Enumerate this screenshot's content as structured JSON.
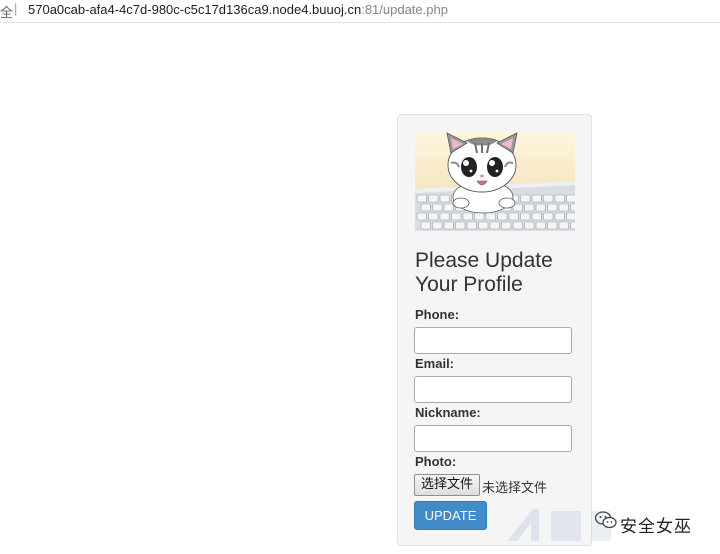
{
  "browser": {
    "secure_label": "全",
    "separator": "|",
    "url_host": "570a0cab-afa4-4c7d-980c-c5c17d136ca9.node4.buuoj.cn",
    "url_path": ":81/update.php"
  },
  "form": {
    "hero_image": "cat-on-keyboard-image",
    "title": "Please Update Your Profile",
    "phone_label": "Phone:",
    "phone_value": "",
    "email_label": "Email:",
    "email_value": "",
    "nickname_label": "Nickname:",
    "nickname_value": "",
    "photo_label": "Photo:",
    "file_button_label": "选择文件",
    "file_status": "未选择文件",
    "submit_label": "UPDATE"
  },
  "watermark": {
    "text": "安全女巫",
    "icon": "wechat-icon"
  },
  "colors": {
    "card_bg": "#f5f5f5",
    "primary_button": "#428bca",
    "text": "#333333"
  }
}
